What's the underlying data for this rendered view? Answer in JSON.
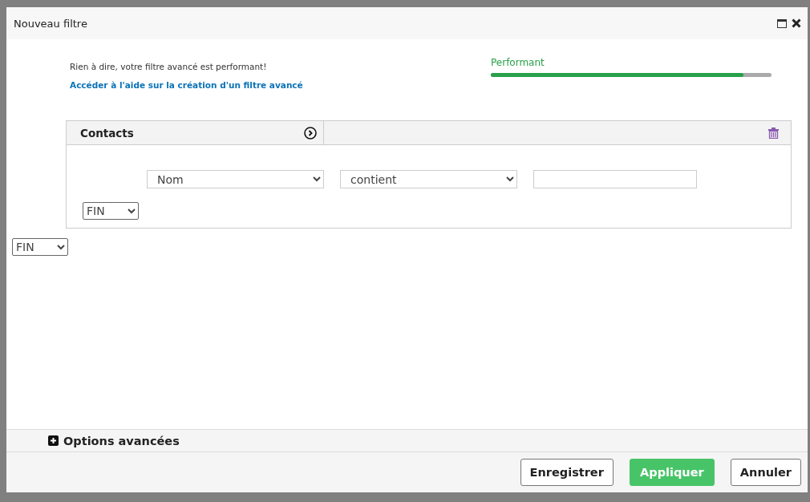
{
  "window": {
    "title": "Nouveau filtre"
  },
  "performance": {
    "message": "Rien à dire, votre filtre avancé est performant!",
    "help_link": "Accéder à l'aide sur la création d'un filtre avancé",
    "label": "Performant",
    "level": 0.9
  },
  "group": {
    "title": "Contacts",
    "condition": {
      "field": "Nom",
      "operator": "contient"
    },
    "inner_end": "FIN"
  },
  "outer_end": "FIN",
  "advanced_options": {
    "label": "Options avancées",
    "expanded": false
  },
  "buttons": [
    {
      "label": "Enregistrer",
      "kind": "secondary"
    },
    {
      "label": "Appliquer",
      "kind": "primary"
    },
    {
      "label": "Annuler",
      "kind": "secondary"
    }
  ]
}
